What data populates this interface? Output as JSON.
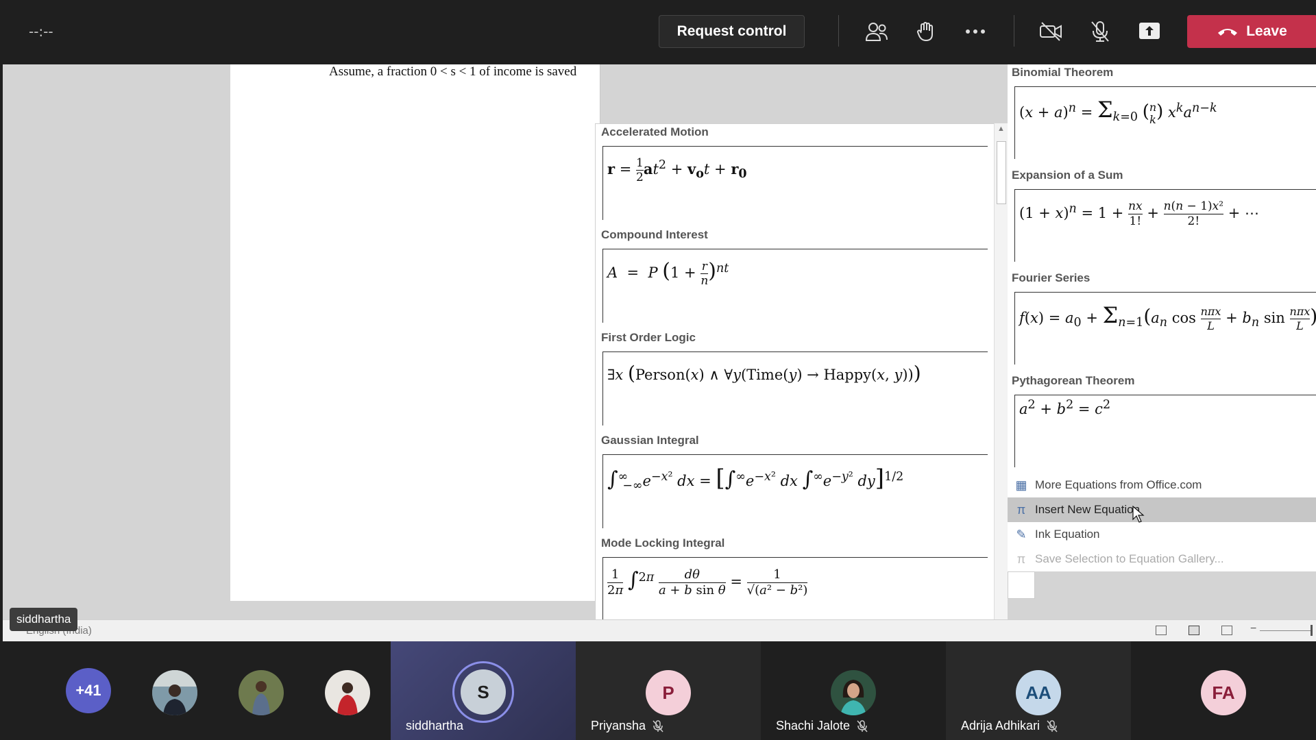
{
  "topbar": {
    "timer": "--:--",
    "request_control": "Request control",
    "leave": "Leave"
  },
  "document": {
    "line": "Assume, a fraction 0 < s < 1 of income is saved"
  },
  "gallery_left": [
    {
      "title": "Accelerated Motion",
      "formula": "r = ½at² + v₀t + r₀"
    },
    {
      "title": "Compound Interest",
      "formula": "A = P(1 + r/n)ⁿᵗ"
    },
    {
      "title": "First Order Logic",
      "formula": "∃x(Person(x) ∧ ∀y(Time(y) → Happy(x, y)))"
    },
    {
      "title": "Gaussian Integral",
      "formula": "∫₋∞^∞ e^(−x²) dx = [∫₋∞^∞ e^(−x²) dx ∫₋∞^∞ e^(−y²) dy]^(1/2)"
    },
    {
      "title": "Mode Locking Integral",
      "formula": "1/2π ∫₀^2π dθ/(a + b sin θ) = 1/√(a² − b²)"
    }
  ],
  "gallery_right": [
    {
      "title": "Binomial Theorem",
      "formula": "(x + a)ⁿ = Σₖ₌₀ⁿ (n k) xᵏaⁿ⁻ᵏ"
    },
    {
      "title": "Expansion of a Sum",
      "formula": "(1 + x)ⁿ = 1 + nx/1! + n(n − 1)x²/2! + ⋯"
    },
    {
      "title": "Fourier Series",
      "formula": "f(x) = a₀ + Σₙ₌₁^∞ (aₙ cos nπx/L + bₙ sin nπx/L)"
    },
    {
      "title": "Pythagorean Theorem",
      "formula": "a² + b² = c²"
    }
  ],
  "menu": {
    "items": [
      {
        "label": "More Equations from Office.com",
        "state": "normal"
      },
      {
        "label": "Insert New Equation",
        "state": "highlighted"
      },
      {
        "label": "Ink Equation",
        "state": "normal"
      },
      {
        "label": "Save Selection to Equation Gallery...",
        "state": "disabled"
      }
    ]
  },
  "statusbar": {
    "language": "English (India)"
  },
  "presenter_tag": "siddhartha",
  "participants": {
    "overflow": "+41",
    "tiles": [
      {
        "initial": "S",
        "name": "siddhartha",
        "muted": false
      },
      {
        "initial": "P",
        "name": "Priyansha",
        "muted": true
      },
      {
        "initial": "",
        "name": "Shachi Jalote",
        "muted": true
      },
      {
        "initial": "AA",
        "name": "Adrija Adhikari",
        "muted": true
      },
      {
        "initial": "FA",
        "name": "",
        "muted": false
      }
    ]
  },
  "colors": {
    "leave": "#c4314b",
    "menu_highlight": "#c6c6c6",
    "overflow_avatar": "#5b5fc7",
    "active_tile": "#3d3e66"
  }
}
